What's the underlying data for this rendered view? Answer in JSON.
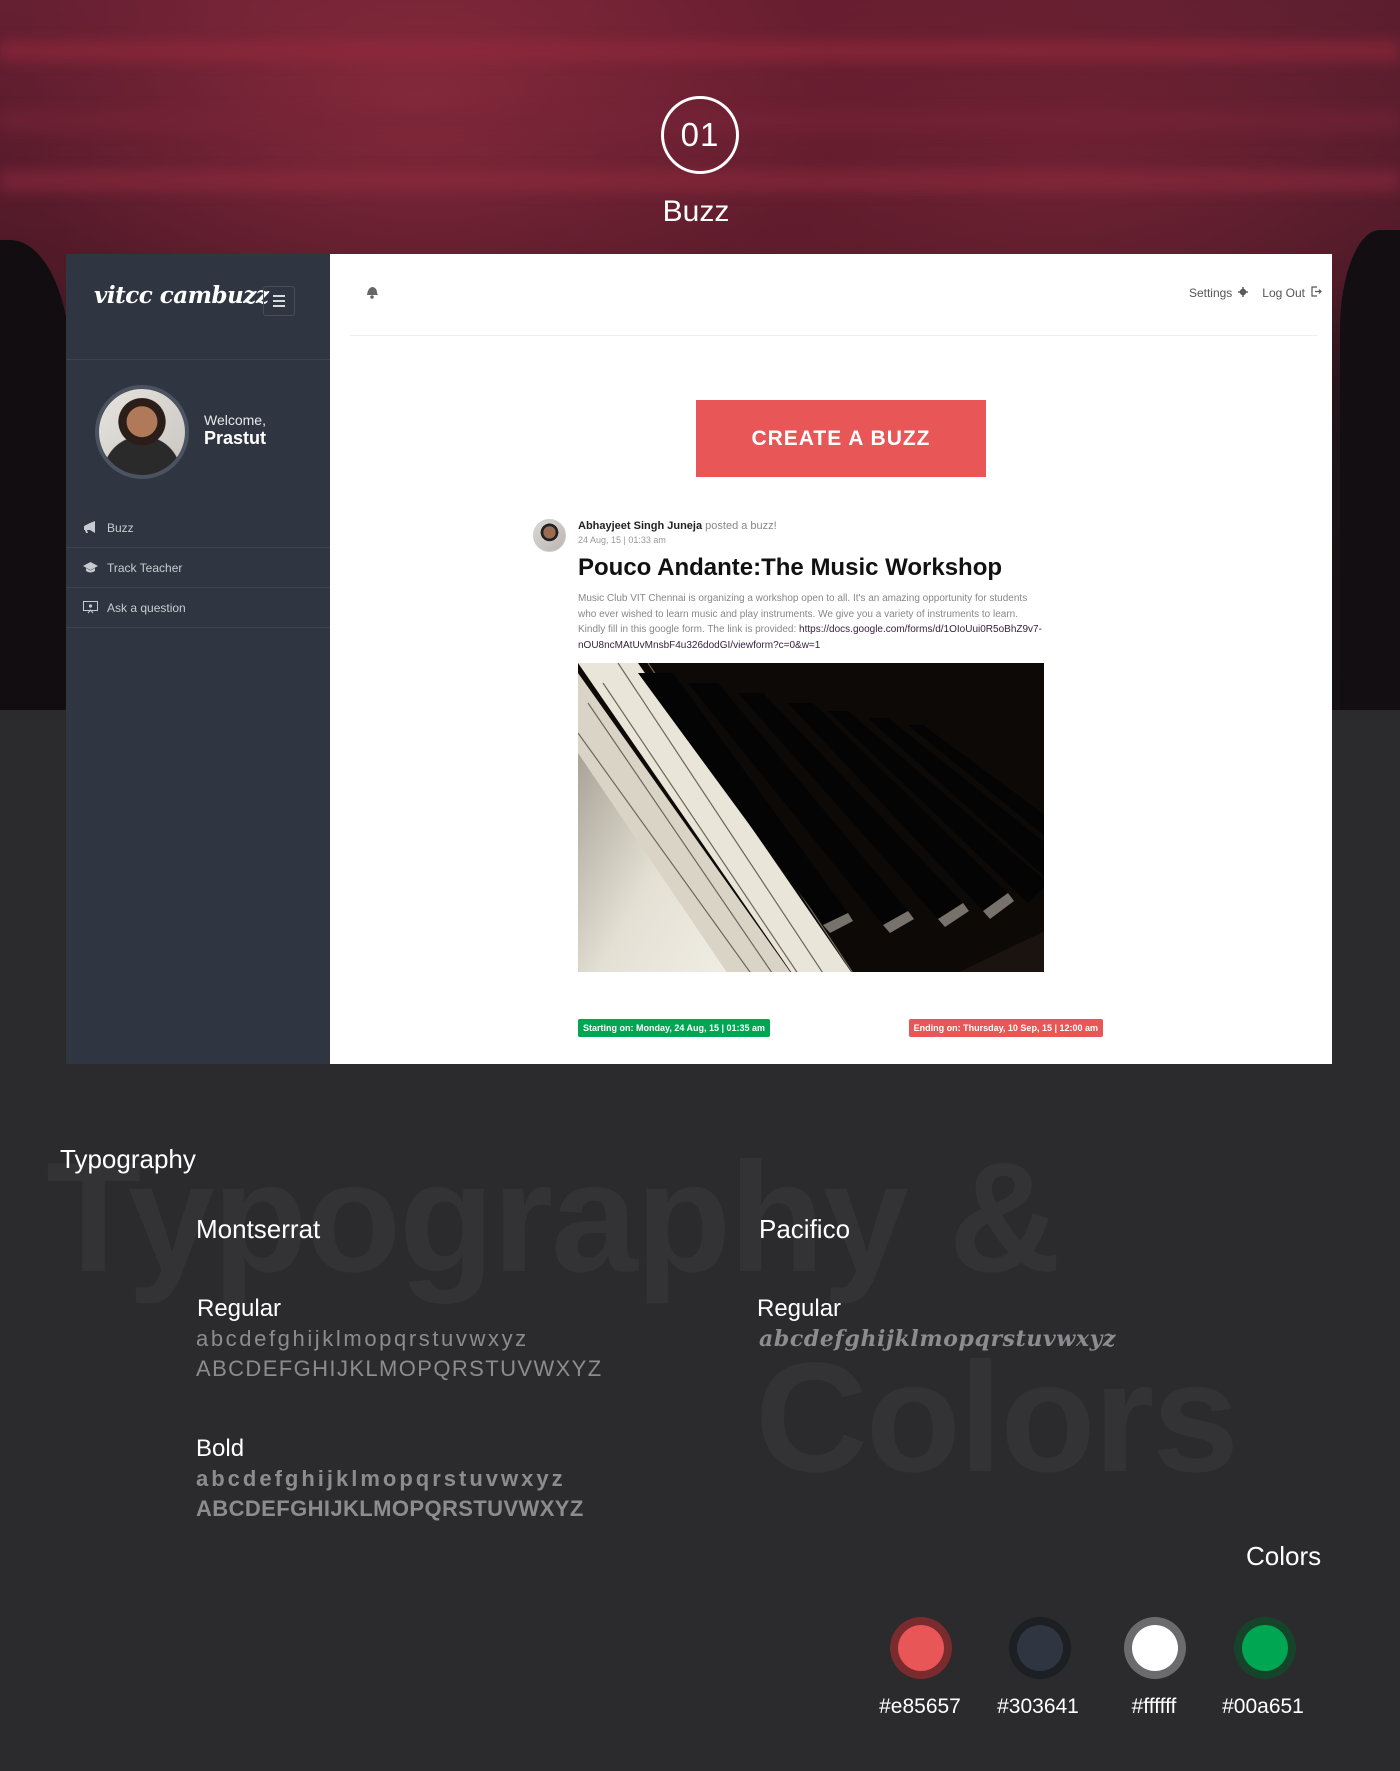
{
  "hero": {
    "step_number": "01",
    "step_title": "Buzz"
  },
  "app": {
    "brand": "vitcc cambuzz",
    "user": {
      "welcome": "Welcome,",
      "name": "Prastut"
    },
    "nav": [
      {
        "label": "Buzz",
        "icon": "megaphone-icon"
      },
      {
        "label": "Track Teacher",
        "icon": "graduation-cap-icon"
      },
      {
        "label": "Ask a question",
        "icon": "question-board-icon"
      }
    ],
    "topbar": {
      "settings_label": "Settings",
      "logout_label": "Log Out"
    },
    "create_button": "CREATE A BUZZ",
    "post": {
      "author": "Abhayjeet Singh Juneja",
      "action": "posted a buzz!",
      "date": "24 Aug, 15 | 01:33 am",
      "title": "Pouco Andante:The Music Workshop",
      "body": "Music Club VIT Chennai is organizing a workshop open to all. It's an amazing opportunity for students who ever wished to learn music and play instruments. We give you a variety of instruments to learn. Kindly fill in this google form. The link is provided:",
      "link": "https://docs.google.com/forms/d/1OIoUui0R5oBhZ9v7-nOU8ncMAtUvMnsbF4u326dodGI/viewform?c=0&w=1",
      "image": "piano-keys-photo",
      "starting": "Starting on: Monday, 24 Aug, 15 | 01:35 am",
      "ending": "Ending on: Thursday, 10 Sep, 15 | 12:00 am"
    }
  },
  "styleguide": {
    "ghost_line1": "Typography &",
    "ghost_line2": "Colors",
    "typography_title": "Typography",
    "font1": {
      "name": "Montserrat",
      "regular_label": "Regular",
      "regular_lower": "abcdefghijklmopqrstuvwxyz",
      "regular_upper": "ABCDEFGHIJKLMOPQRSTUVWXYZ",
      "bold_label": "Bold",
      "bold_lower": "abcdefghijklmopqrstuvwxyz",
      "bold_upper": "ABCDEFGHIJKLMOPQRSTUVWXYZ"
    },
    "font2": {
      "name": "Pacifico",
      "regular_label": "Regular",
      "regular_lower": "abcdefghijklmopqrstuvwxyz"
    },
    "colors_title": "Colors",
    "colors": [
      {
        "hex": "#e85657",
        "label": "#e85657"
      },
      {
        "hex": "#303641",
        "label": "#303641"
      },
      {
        "hex": "#ffffff",
        "label": "#ffffff"
      },
      {
        "hex": "#00a651",
        "label": "#00a651"
      }
    ]
  }
}
